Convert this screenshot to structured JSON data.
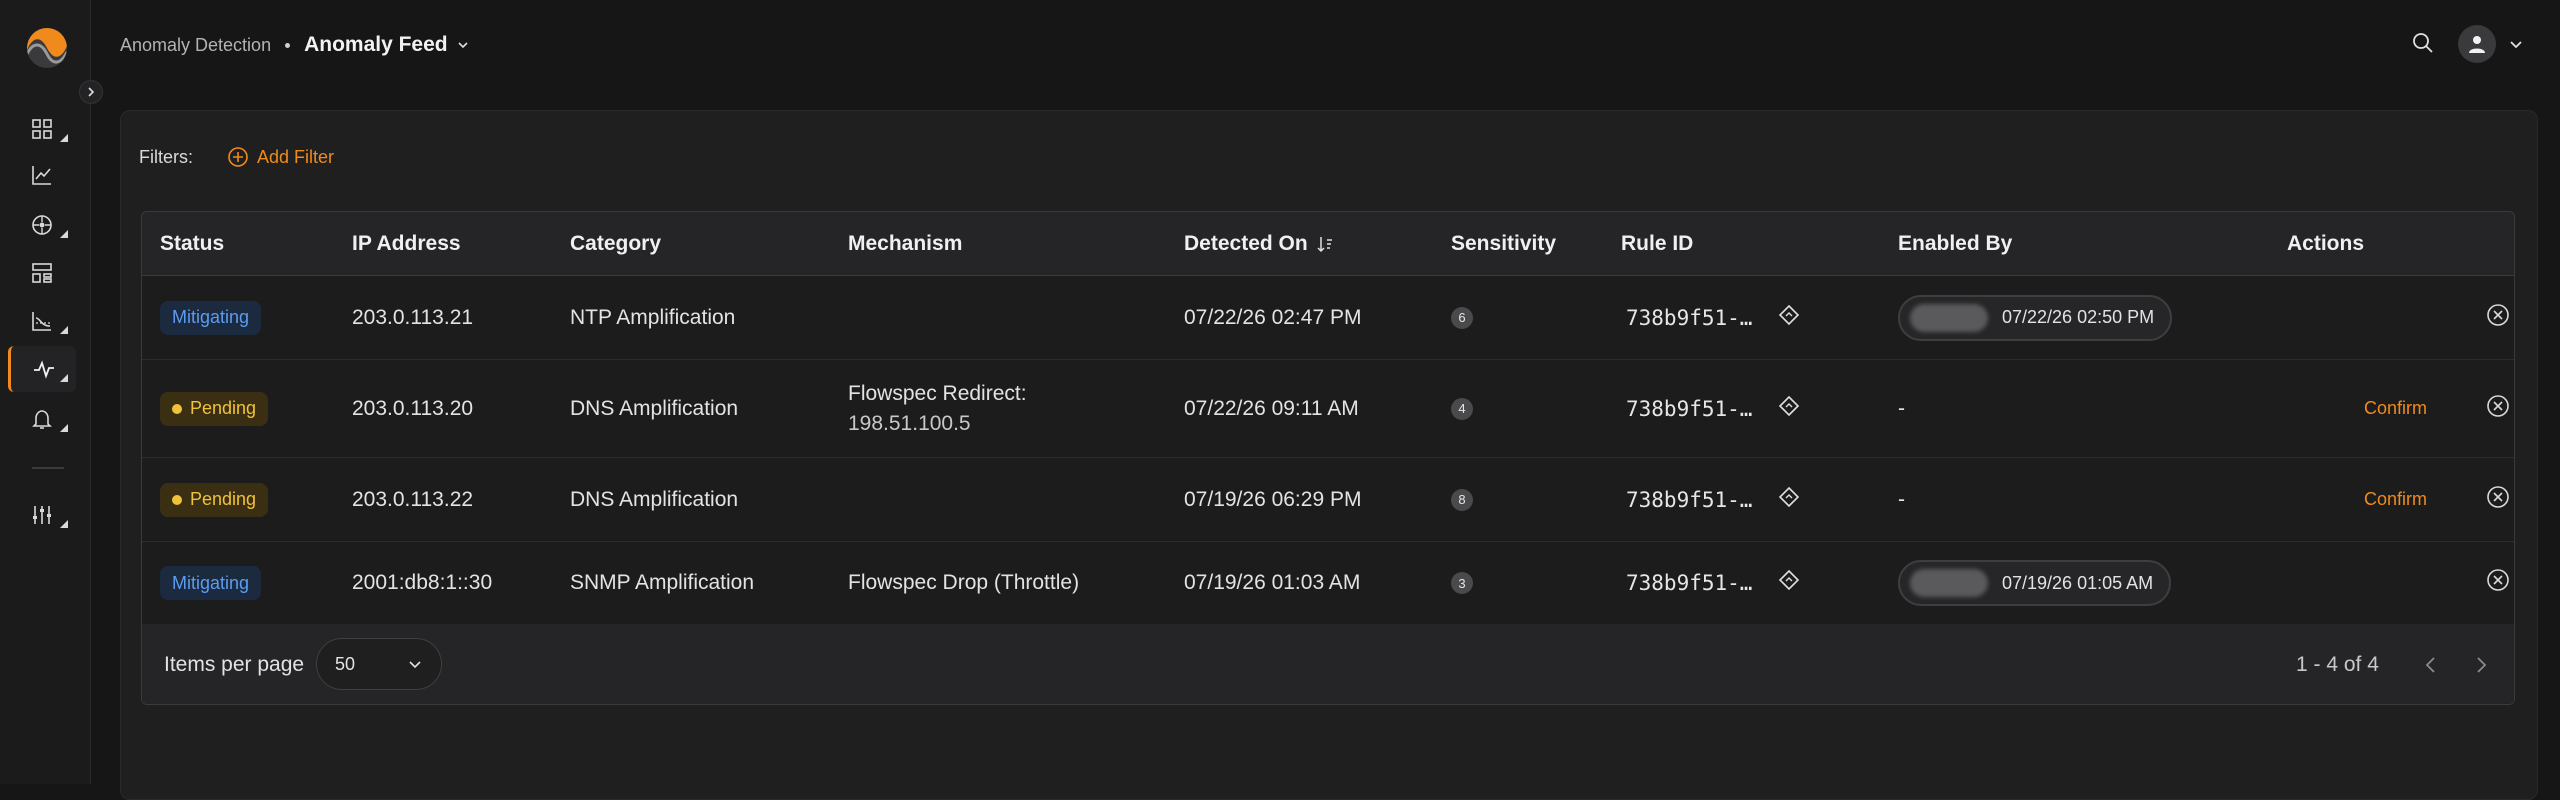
{
  "colors": {
    "accent": "#f08a1c",
    "mitigating": "#5b9cf0",
    "pending": "#f0c23a"
  },
  "sidebar": {
    "items": [
      {
        "icon": "dashboard-icon"
      },
      {
        "icon": "line-chart-icon"
      },
      {
        "icon": "network-icon"
      },
      {
        "icon": "layout-icon"
      },
      {
        "icon": "analytics-icon"
      },
      {
        "icon": "anomaly-pulse-icon",
        "active": true
      },
      {
        "icon": "bell-icon"
      },
      {
        "icon": "sliders-icon"
      }
    ]
  },
  "header": {
    "breadcrumb_parent": "Anomaly Detection",
    "breadcrumb_current": "Anomaly Feed"
  },
  "filters": {
    "label": "Filters:",
    "add_label": "Add Filter"
  },
  "table": {
    "columns": [
      "Status",
      "IP Address",
      "Category",
      "Mechanism",
      "Detected On",
      "Sensitivity",
      "Rule ID",
      "Enabled By",
      "Actions"
    ],
    "rows": [
      {
        "status": "Mitigating",
        "ip": "203.0.113.21",
        "category": "NTP Amplification",
        "mechanism_1": "",
        "mechanism_2": "",
        "detected": "07/22/26 02:47 PM",
        "sensitivity": "6",
        "rule": "738b9f51-…",
        "enabled_time": "07/22/26 02:50 PM",
        "enabled_dash": "",
        "action": ""
      },
      {
        "status": "Pending",
        "ip": "203.0.113.20",
        "category": "DNS Amplification",
        "mechanism_1": "Flowspec Redirect:",
        "mechanism_2": "198.51.100.5",
        "detected": "07/22/26 09:11 AM",
        "sensitivity": "4",
        "rule": "738b9f51-…",
        "enabled_time": "",
        "enabled_dash": "-",
        "action": "Confirm"
      },
      {
        "status": "Pending",
        "ip": "203.0.113.22",
        "category": "DNS Amplification",
        "mechanism_1": "",
        "mechanism_2": "",
        "detected": "07/19/26 06:29 PM",
        "sensitivity": "8",
        "rule": "738b9f51-…",
        "enabled_time": "",
        "enabled_dash": "-",
        "action": "Confirm"
      },
      {
        "status": "Mitigating",
        "ip": "2001:db8:1::30",
        "category": "SNMP Amplification",
        "mechanism_1": "Flowspec Drop (Throttle)",
        "mechanism_2": "",
        "detected": "07/19/26 01:03 AM",
        "sensitivity": "3",
        "rule": "738b9f51-…",
        "enabled_time": "07/19/26 01:05 AM",
        "enabled_dash": "",
        "action": ""
      }
    ]
  },
  "pagination": {
    "items_per_page_label": "Items per page",
    "items_per_page_value": "50",
    "range_text": "1 - 4 of 4"
  }
}
